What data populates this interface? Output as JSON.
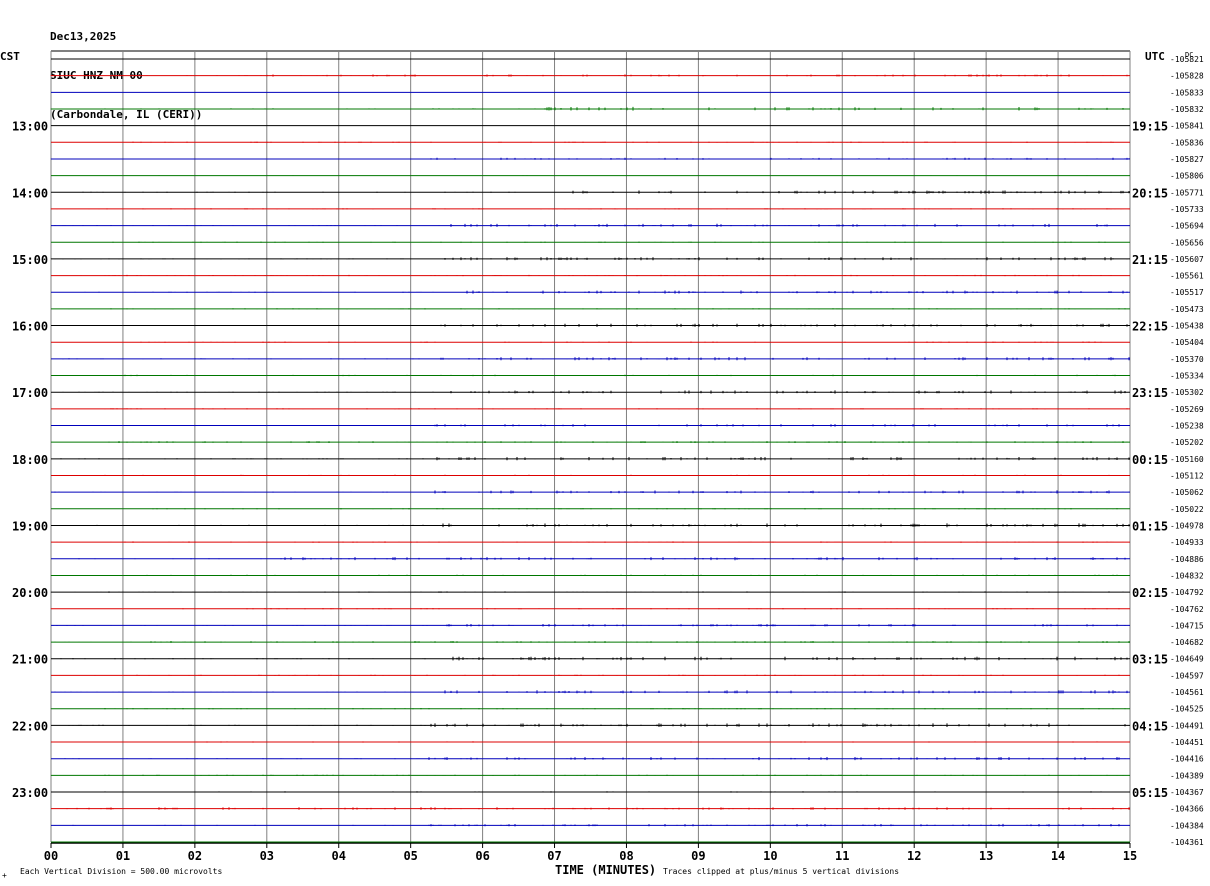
{
  "header": {
    "date": "Dec13,2025",
    "station": "SIUC HNZ NM 00",
    "location": "(Carbondale, IL (CERI))"
  },
  "left_timezone": "CST",
  "right_timezone": "UTC",
  "dc_label": "DC",
  "footer": {
    "scale_note": "Each Vertical Division =  500.00 microvolts",
    "xlabel": "TIME (MINUTES)",
    "clip_note": "Traces clipped at plus/minus 5 vertical divisions",
    "corner_mark": "+"
  },
  "colors": {
    "black": "#000000",
    "red": "#dd0000",
    "blue": "#0000bb",
    "green": "#007700",
    "grid": "#808080"
  },
  "chart_data": {
    "type": "line",
    "title": "SIUC HNZ NM 00",
    "xlabel": "TIME (MINUTES)",
    "xlim": [
      0,
      15
    ],
    "x_ticks": [
      "00",
      "01",
      "02",
      "03",
      "04",
      "05",
      "06",
      "07",
      "08",
      "09",
      "10",
      "11",
      "12",
      "13",
      "14",
      "15"
    ],
    "trace_colors": [
      "black",
      "red",
      "blue",
      "green"
    ],
    "left_hour_labels": [
      "13:00",
      "14:00",
      "15:00",
      "16:00",
      "17:00",
      "18:00",
      "19:00",
      "20:00",
      "21:00",
      "22:00",
      "23:00"
    ],
    "right_hour_labels": [
      "19:15",
      "20:15",
      "21:15",
      "22:15",
      "23:15",
      "00:15",
      "01:15",
      "02:15",
      "03:15",
      "04:15",
      "05:15"
    ],
    "dc_offsets": [
      "-105821",
      "-105828",
      "-105833",
      "-105832",
      "-105841",
      "-105836",
      "-105827",
      "-105806",
      "-105771",
      "-105733",
      "-105694",
      "-105656",
      "-105607",
      "-105561",
      "-105517",
      "-105473",
      "-105438",
      "-105404",
      "-105370",
      "-105334",
      "-105302",
      "-105269",
      "-105238",
      "-105202",
      "-105160",
      "-105112",
      "-105062",
      "-105022",
      "-104978",
      "-104933",
      "-104886",
      "-104832",
      "-104792",
      "-104762",
      "-104715",
      "-104682",
      "-104649",
      "-104597",
      "-104561",
      "-104525",
      "-104491",
      "-104451",
      "-104416",
      "-104389",
      "-104367",
      "-104366",
      "-104384",
      "-104361"
    ],
    "activity": [
      [
        0.0,
        0.02
      ],
      [
        0.2,
        0.35
      ],
      [
        0.0,
        0.02
      ],
      [
        0.45,
        0.6
      ],
      [
        0.0,
        0.02
      ],
      [
        0.05,
        0.2
      ],
      [
        0.35,
        0.35
      ],
      [
        0.0,
        0.05
      ],
      [
        0.45,
        0.5
      ],
      [
        0.05,
        0.2
      ],
      [
        0.35,
        0.5
      ],
      [
        0.05,
        0.2
      ],
      [
        0.35,
        0.5
      ],
      [
        0.05,
        0.2
      ],
      [
        0.35,
        0.5
      ],
      [
        0.05,
        0.2
      ],
      [
        0.35,
        0.5
      ],
      [
        0.05,
        0.2
      ],
      [
        0.35,
        0.5
      ],
      [
        0.05,
        0.2
      ],
      [
        0.35,
        0.5
      ],
      [
        0.05,
        0.2
      ],
      [
        0.35,
        0.4
      ],
      [
        0.05,
        0.3
      ],
      [
        0.35,
        0.55
      ],
      [
        0.05,
        0.2
      ],
      [
        0.35,
        0.5
      ],
      [
        0.05,
        0.2
      ],
      [
        0.35,
        0.6
      ],
      [
        0.05,
        0.2
      ],
      [
        0.2,
        0.5
      ],
      [
        0.05,
        0.2
      ],
      [
        0.05,
        0.2
      ],
      [
        0.05,
        0.2
      ],
      [
        0.35,
        0.4
      ],
      [
        0.05,
        0.3
      ],
      [
        0.35,
        0.6
      ],
      [
        0.05,
        0.2
      ],
      [
        0.35,
        0.5
      ],
      [
        0.05,
        0.2
      ],
      [
        0.35,
        0.6
      ],
      [
        0.05,
        0.2
      ],
      [
        0.35,
        0.5
      ],
      [
        0.05,
        0.2
      ],
      [
        0.0,
        0.2
      ],
      [
        0.0,
        0.4
      ],
      [
        0.35,
        0.4
      ],
      [
        0.05,
        0.1
      ]
    ]
  }
}
